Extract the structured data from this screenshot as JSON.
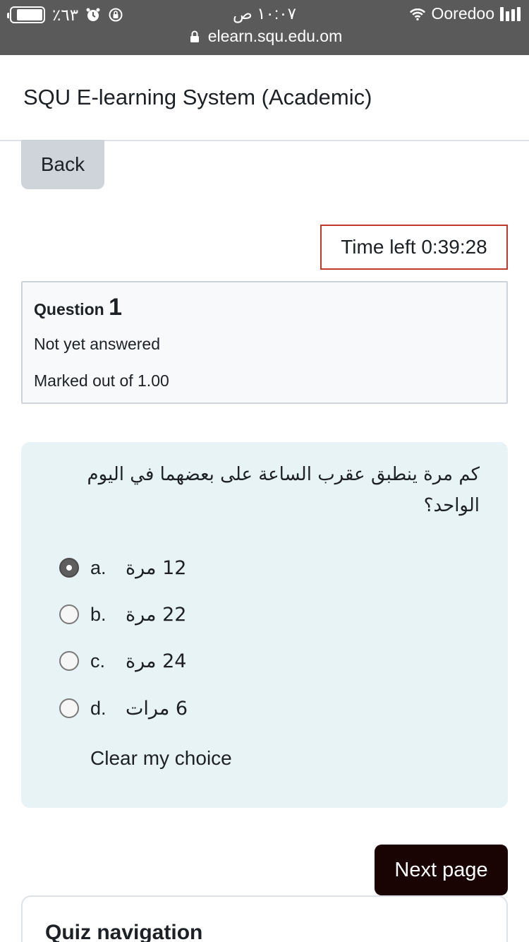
{
  "status_bar": {
    "battery": "٪٦٣",
    "time": "١٠:٠٧ ص",
    "carrier": "Ooredoo",
    "url": "elearn.squ.edu.om",
    "icons": [
      "battery-icon",
      "alarm-icon",
      "rotation-lock-icon",
      "wifi-icon",
      "signal-icon",
      "lock-icon"
    ]
  },
  "header": {
    "site_title": "SQU E-learning System (Academic)"
  },
  "back_button": "Back",
  "timer": "Time left 0:39:28",
  "question_info": {
    "label": "Question",
    "number": "1",
    "state": "Not yet answered",
    "grade": "Marked out of 1.00"
  },
  "question": {
    "text": "كم مرة ينطبق عقرب الساعة على بعضهما في اليوم الواحد؟",
    "selected": "a",
    "options": [
      {
        "letter": "a.",
        "text": "12 مرة"
      },
      {
        "letter": "b.",
        "text": "22 مرة"
      },
      {
        "letter": "c.",
        "text": "24 مرة"
      },
      {
        "letter": "d.",
        "text": "6 مرات"
      }
    ],
    "clear_choice": "Clear my choice"
  },
  "next_button": "Next page",
  "quiz_navigation": {
    "title": "Quiz navigation"
  },
  "colors": {
    "status_bar_bg": "#5a5a5a",
    "timer_border": "#c0392b",
    "question_bg": "#e7f3f5",
    "next_button_bg": "#1a0303",
    "back_button_bg": "#ced4da"
  }
}
